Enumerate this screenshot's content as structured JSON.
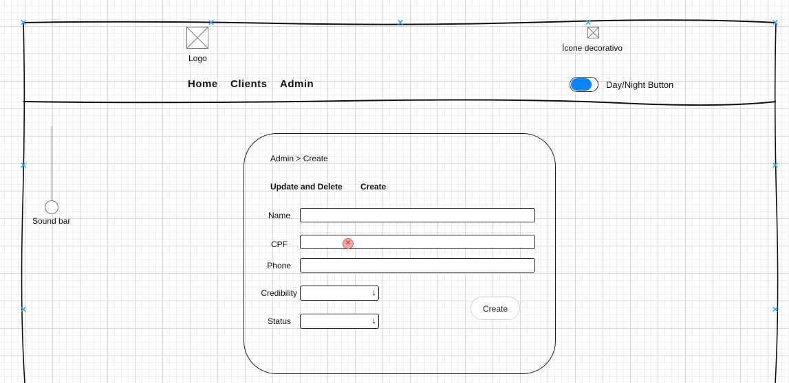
{
  "header": {
    "logo_label": "Logo",
    "decorative_icon_label": "Ícone decorativo",
    "nav": {
      "home": "Home",
      "clients": "Clients",
      "admin": "Admin"
    },
    "toggle_label": "Day/Night Button",
    "toggle_color": "#0a84ff"
  },
  "sidebar": {
    "sound_bar_label": "Sound bar"
  },
  "card": {
    "breadcrumb": "Admin > Create",
    "tabs": {
      "update_delete": "Update and Delete",
      "create": "Create"
    },
    "fields": {
      "name_label": "Name",
      "cpf_label": "CPF",
      "phone_label": "Phone",
      "credibility_label": "Credibility",
      "status_label": "Status"
    },
    "create_button": "Create",
    "dropdown_arrow": "↓"
  },
  "accent_colors": {
    "selection_marker": "#3fa9f5",
    "error_marker": "#f4a5a5"
  }
}
